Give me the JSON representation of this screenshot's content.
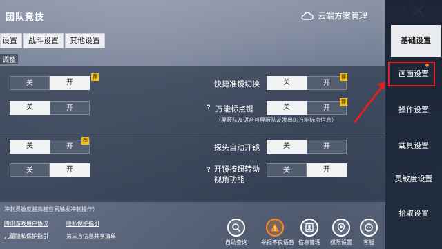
{
  "header": {
    "title": "团队竞技",
    "cloud_link": "云端方案管理",
    "top_right": "设置"
  },
  "subtabs": [
    "设置",
    "战斗设置",
    "其他设置"
  ],
  "section_label": "调整",
  "recommend_badge": "荐",
  "rows": [
    {
      "left_off": "关",
      "left_on": "开",
      "right_label": "快捷准镜切换",
      "right_off": "关",
      "right_on": "开"
    },
    {
      "left_off": "关",
      "left_on": "开",
      "right_label": "万能标点键",
      "right_note": "（屏蔽队友语音可屏蔽队友发出的万能标点信息）",
      "right_off": "关",
      "right_on": "开"
    },
    {
      "left_off": "关",
      "left_on": "开",
      "right_label": "探头自动开镜",
      "right_off": "关",
      "right_on": "开"
    },
    {
      "left_off": "关",
      "left_on": "开",
      "right_label_line1": "开镜按钮转动",
      "right_label_line2": "视角功能",
      "right_off": "关",
      "right_on": "开"
    }
  ],
  "bottom_hint": "冲刺灵敏度越高越容易触发冲刺操作）",
  "footer_links": [
    "腾讯游戏用户协议",
    "隐私保护指引",
    "儿童隐私保护指引",
    "第三方信息共享清单"
  ],
  "bottom_icons": [
    {
      "label": "自助查询",
      "icon": "search-icon"
    },
    {
      "label": "举报不良语音",
      "icon": "warning-icon"
    },
    {
      "label": "信息管理",
      "icon": "id-card-icon"
    },
    {
      "label": "权限设置",
      "icon": "location-shield-icon"
    },
    {
      "label": "客服",
      "icon": "headset-icon"
    }
  ],
  "sidebar": {
    "items": [
      "基础设置",
      "画面设置",
      "操作设置",
      "载具设置",
      "灵敏度设置",
      "拾取设置"
    ],
    "active_index": 0,
    "highlighted_index": 1
  },
  "colors": {
    "highlight": "#e02020",
    "badge": "#f0c21a",
    "alert_orange": "#ff8a1d"
  }
}
